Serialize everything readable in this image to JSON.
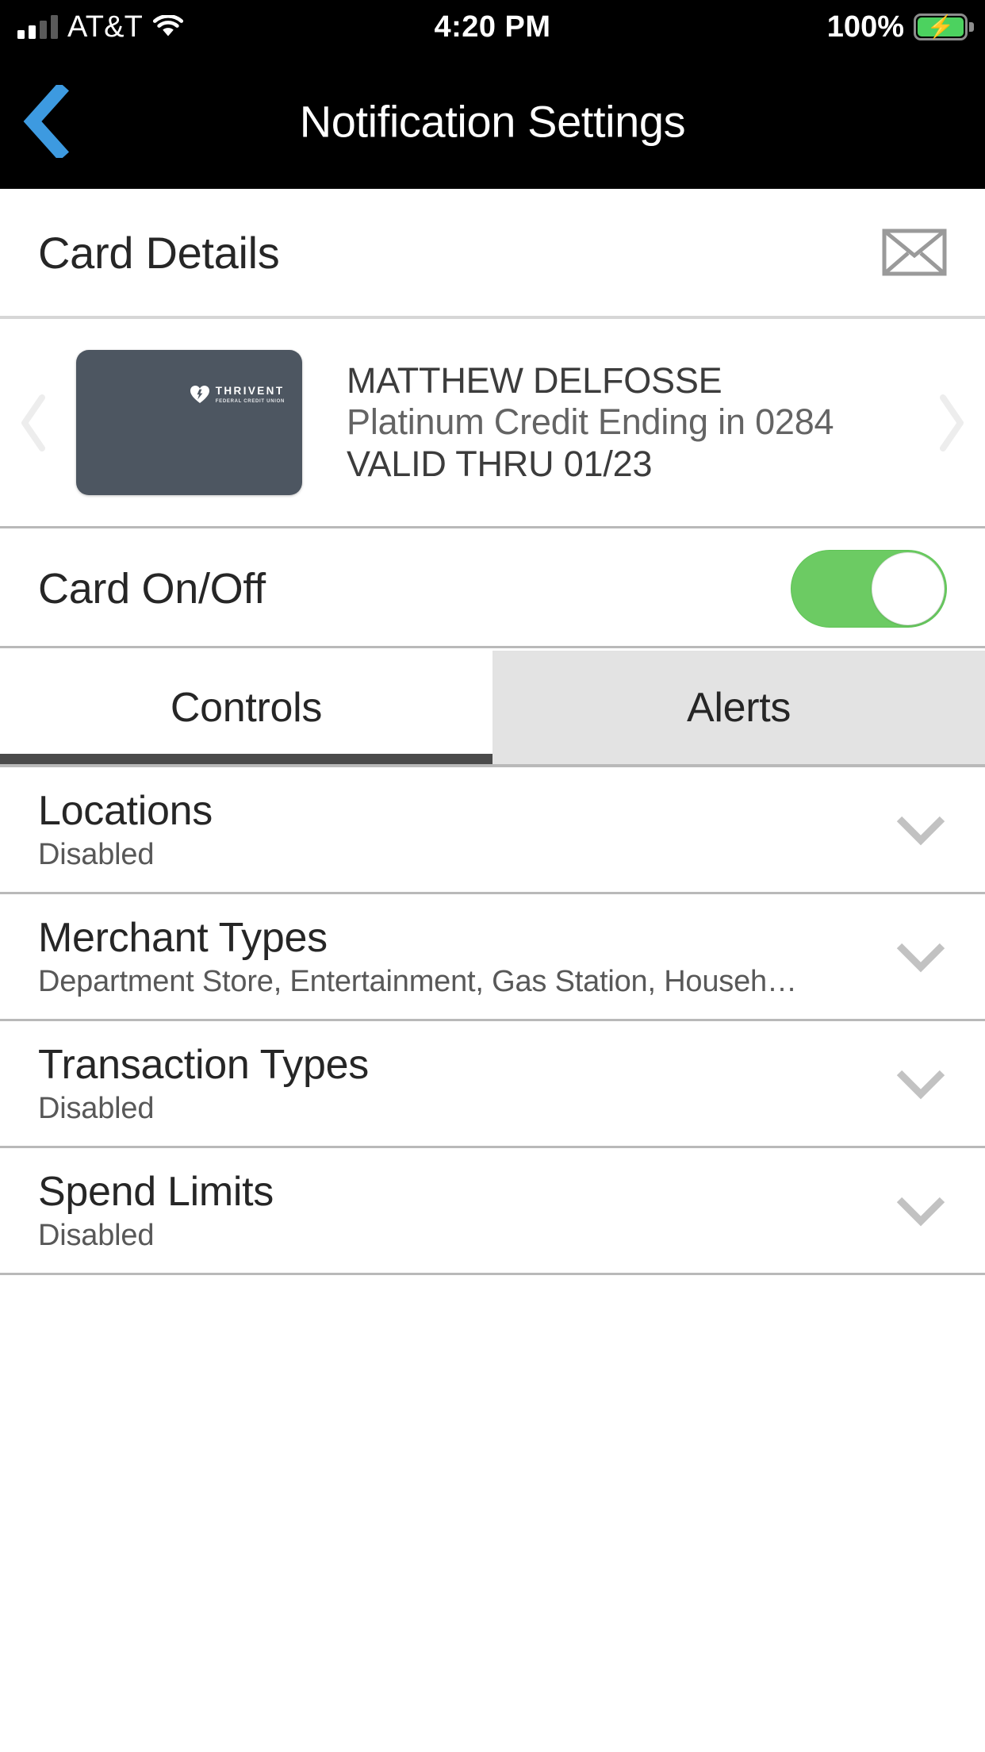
{
  "status_bar": {
    "carrier": "AT&T",
    "time": "4:20 PM",
    "battery_percent": "100%",
    "signal_icon": "signal-bars-icon",
    "wifi_icon": "wifi-icon",
    "battery_icon": "battery-charging-icon"
  },
  "nav": {
    "back_icon": "chevron-left-icon",
    "title": "Notification Settings",
    "back_color": "#3d9ae0"
  },
  "card_details": {
    "title": "Card Details",
    "mail_icon": "envelope-icon"
  },
  "carousel": {
    "prev_icon": "chevron-left-icon",
    "next_icon": "chevron-right-icon",
    "card": {
      "brand_name": "THRIVENT",
      "brand_sub": "FEDERAL CREDIT UNION",
      "art_color": "#4d5661",
      "holder_name": "MATTHEW DELFOSSE",
      "description": "Platinum Credit Ending in 0284",
      "valid_thru": "VALID THRU 01/23"
    }
  },
  "card_on_off": {
    "label": "Card On/Off",
    "state": "on",
    "on_color": "#6ccb63"
  },
  "tabs": [
    {
      "label": "Controls",
      "active": true
    },
    {
      "label": "Alerts",
      "active": false
    }
  ],
  "settings_rows": [
    {
      "title": "Locations",
      "subtitle": "Disabled",
      "chevron": "chevron-down-icon"
    },
    {
      "title": "Merchant Types",
      "subtitle": "Department Store, Entertainment, Gas Station, Househ…",
      "chevron": "chevron-down-icon"
    },
    {
      "title": "Transaction Types",
      "subtitle": "Disabled",
      "chevron": "chevron-down-icon"
    },
    {
      "title": "Spend Limits",
      "subtitle": "Disabled",
      "chevron": "chevron-down-icon"
    }
  ]
}
